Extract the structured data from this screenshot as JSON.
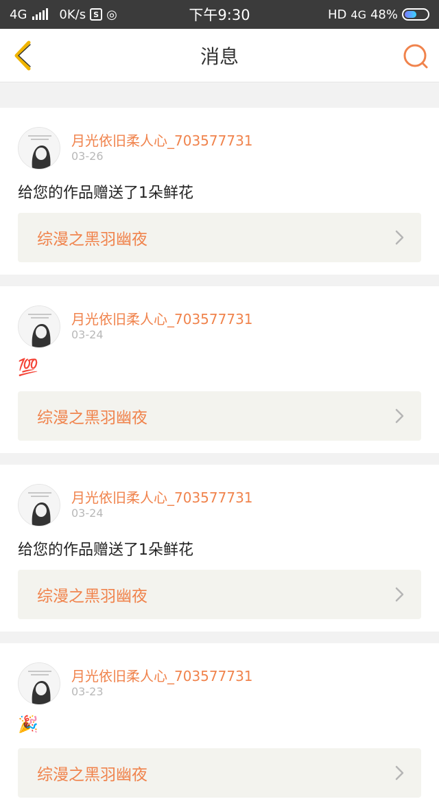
{
  "status_bar": {
    "network": "4G",
    "speed": "0K/s",
    "time": "下午9:30",
    "hd": "HD",
    "network_right": "4G",
    "battery": "48%",
    "battery_level": 0.48
  },
  "nav": {
    "title": "消息",
    "accent_color": "#f0834c"
  },
  "messages": [
    {
      "username": "月光依旧柔人心_703577731",
      "date": "03-26",
      "content": "给您的作品赠送了1朵鲜花",
      "work_title": "综漫之黑羽幽夜"
    },
    {
      "username": "月光依旧柔人心_703577731",
      "date": "03-24",
      "content": "💯",
      "work_title": "综漫之黑羽幽夜"
    },
    {
      "username": "月光依旧柔人心_703577731",
      "date": "03-24",
      "content": "给您的作品赠送了1朵鲜花",
      "work_title": "综漫之黑羽幽夜"
    },
    {
      "username": "月光依旧柔人心_703577731",
      "date": "03-23",
      "content": "🎉",
      "work_title": "综漫之黑羽幽夜"
    }
  ]
}
